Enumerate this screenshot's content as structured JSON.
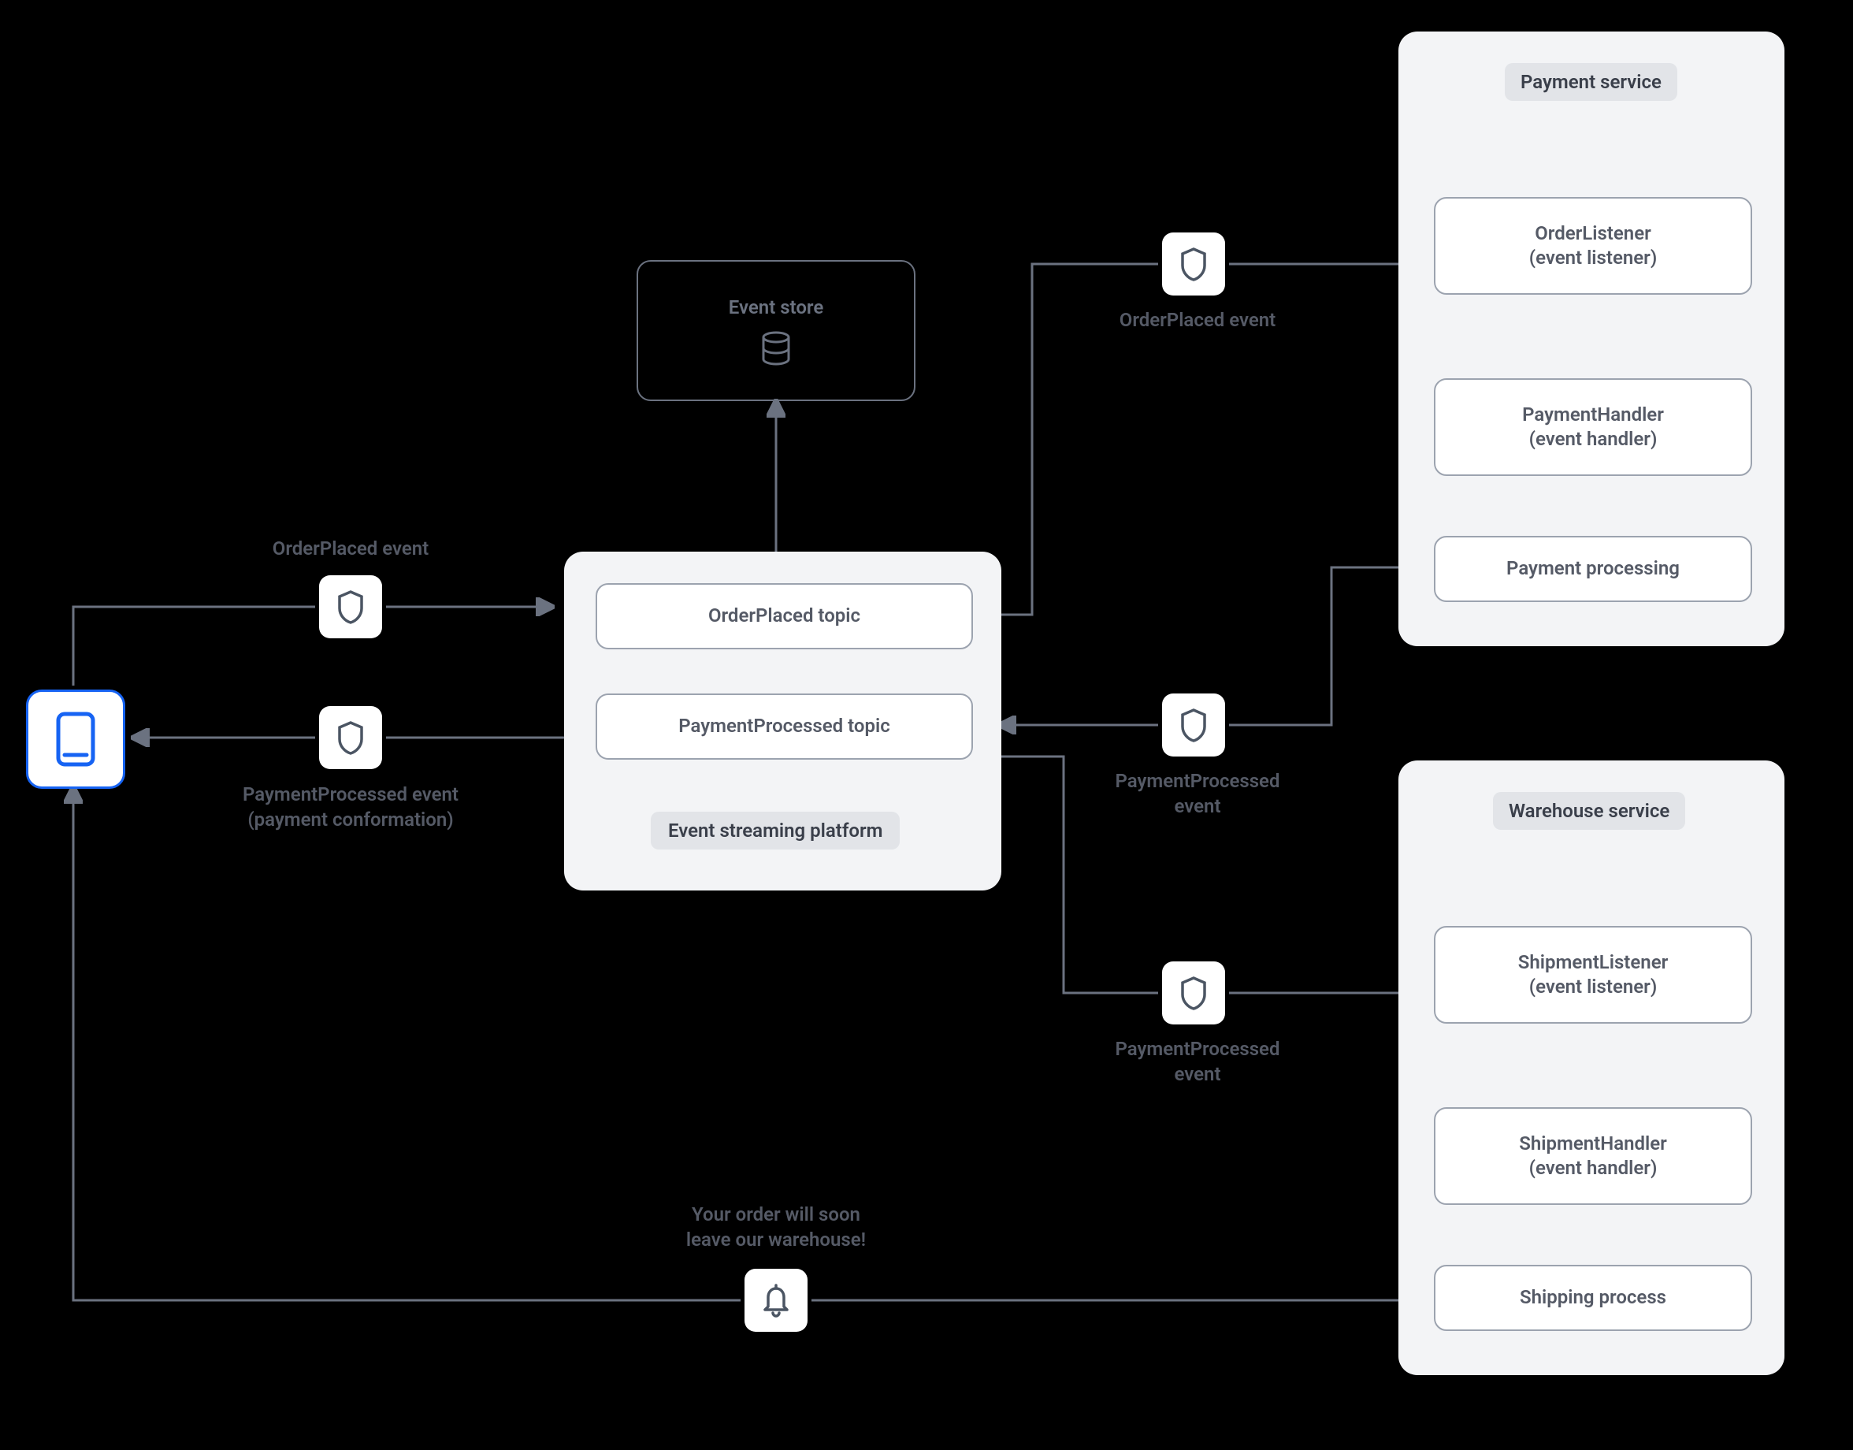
{
  "icons": {
    "phone": "mobile-device",
    "shield": "shield",
    "bell": "bell",
    "db": "database"
  },
  "labels": {
    "order_placed_event": "OrderPlaced event",
    "payment_processed_event_left": "PaymentProcessed event\n(payment conformation)",
    "order_placed_event_right": "OrderPlaced event",
    "payment_processed_event_mid": "PaymentProcessed\nevent",
    "payment_processed_event_lower": "PaymentProcessed\nevent",
    "notification": "Your order will soon\nleave our warehouse!"
  },
  "event_store": {
    "title": "Event store"
  },
  "platform": {
    "title": "Event streaming platform",
    "topic1": "OrderPlaced topic",
    "topic2": "PaymentProcessed topic"
  },
  "payment_service": {
    "title": "Payment service",
    "box1": "OrderListener\n(event listener)",
    "box2": "PaymentHandler\n(event handler)",
    "box3": "Payment processing"
  },
  "warehouse_service": {
    "title": "Warehouse service",
    "box1": "ShipmentListener\n(event listener)",
    "box2": "ShipmentHandler\n(event handler)",
    "box3": "Shipping process"
  },
  "colors": {
    "panel_bg": "#f3f4f6",
    "accent_blue": "#1663f3",
    "stroke_grey": "#6b7280"
  }
}
